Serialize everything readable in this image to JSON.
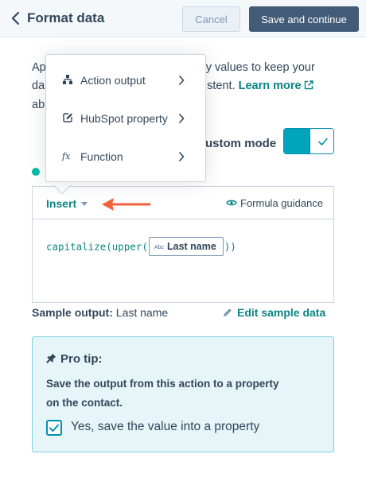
{
  "header": {
    "title": "Format data",
    "cancel_label": "Cancel",
    "save_label": "Save and continue"
  },
  "description": {
    "line1_start": "Ap",
    "line1_end": "y values to keep your",
    "line2_start": "da",
    "line2_end": "stent.",
    "learn_more": "Learn more",
    "line3_start": "ab"
  },
  "mode": {
    "label": "ustom mode",
    "enabled": true
  },
  "insert_menu": {
    "items": [
      {
        "label": "Action output",
        "icon": "branch-icon"
      },
      {
        "label": "HubSpot property",
        "icon": "property-edit-icon"
      },
      {
        "label": "Function",
        "icon": "function-icon",
        "glyph": "fx"
      }
    ]
  },
  "editor": {
    "insert_label": "Insert",
    "guidance_label": "Formula guidance",
    "formula_prefix": "capitalize(upper(",
    "token_type": "Abc",
    "token_label": "Last name",
    "formula_suffix": "))"
  },
  "sample": {
    "label": "Sample output:",
    "value": "Last name",
    "edit_label": "Edit sample data"
  },
  "pro_tip": {
    "title": "Pro tip:",
    "line1": "Save the output from this action to a property",
    "line2": "on the contact.",
    "checkbox_label": "Yes, save the value into a property",
    "checked": true
  },
  "colors": {
    "accent": "#0b8484",
    "toggle": "#00a4bd",
    "header_bg": "#f5f8fa",
    "primary_button": "#425b76",
    "tip_bg": "#e5f5f8",
    "arrow": "#f2613d",
    "status_dot": "#00bda5"
  }
}
